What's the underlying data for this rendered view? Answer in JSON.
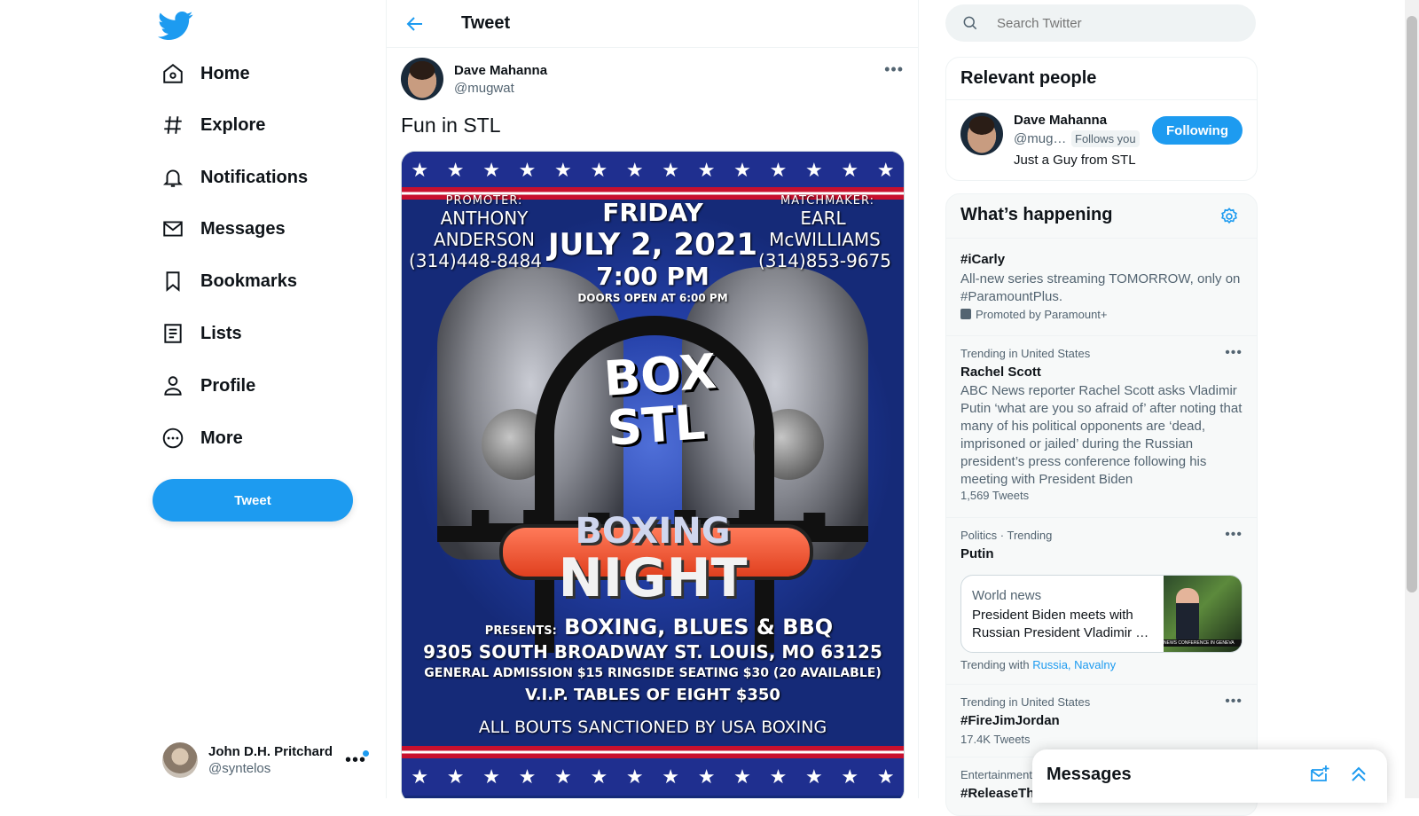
{
  "nav": {
    "items": [
      {
        "label": "Home",
        "icon": "home-icon"
      },
      {
        "label": "Explore",
        "icon": "hashtag-icon"
      },
      {
        "label": "Notifications",
        "icon": "bell-icon"
      },
      {
        "label": "Messages",
        "icon": "envelope-icon"
      },
      {
        "label": "Bookmarks",
        "icon": "bookmark-icon"
      },
      {
        "label": "Lists",
        "icon": "list-icon"
      },
      {
        "label": "Profile",
        "icon": "person-icon"
      },
      {
        "label": "More",
        "icon": "more-circle-icon"
      }
    ],
    "tweet_button": "Tweet"
  },
  "account": {
    "name": "John D.H. Pritchard",
    "handle": "@syntelos"
  },
  "center": {
    "title": "Tweet",
    "author": {
      "name": "Dave Mahanna",
      "handle": "@mugwat"
    },
    "text": "Fun in STL",
    "poster": {
      "promoter_label": "PROMOTER:",
      "promoter_name_1": "ANTHONY",
      "promoter_name_2": "ANDERSON",
      "promoter_phone": "(314)448-8484",
      "matchmaker_label": "MATCHMAKER:",
      "matchmaker_name_1": "EARL",
      "matchmaker_name_2": "McWILLIAMS",
      "matchmaker_phone": "(314)853-9675",
      "day": "FRIDAY",
      "date": "JULY 2, 2021",
      "time": "7:00 PM",
      "doors": "DOORS OPEN AT 6:00 PM",
      "logo": "BOX STL",
      "event_1": "BOXING",
      "event_2": "NIGHT",
      "presents": "PRESENTS:",
      "tagline": "BOXING, BLUES & BBQ",
      "address": "9305 SOUTH BROADWAY ST. LOUIS, MO 63125",
      "pricing": "GENERAL ADMISSION $15  RINGSIDE SEATING $30 (20 AVAILABLE)",
      "vip": "V.I.P. TABLES OF EIGHT $350",
      "sanction": "ALL BOUTS SANCTIONED BY USA BOXING",
      "star": "★"
    }
  },
  "search": {
    "placeholder": "Search Twitter"
  },
  "relevant": {
    "title": "Relevant people",
    "name": "Dave Mahanna",
    "handle": "@mug…",
    "follows_you": "Follows you",
    "bio": "Just a Guy from STL",
    "button": "Following"
  },
  "happening": {
    "title": "What’s happening",
    "trends": [
      {
        "title": "#iCarly",
        "desc": "All-new series streaming TOMORROW, only on #ParamountPlus.",
        "promoted": "Promoted by Paramount+"
      },
      {
        "meta": "Trending in United States",
        "title": "Rachel Scott",
        "desc": "ABC News reporter Rachel Scott asks Vladimir Putin ‘what are you so afraid of’ after noting that many of his political opponents are ‘dead, imprisoned or jailed’ during the Russian president’s press conference following his meeting with President Biden",
        "count": "1,569 Tweets"
      },
      {
        "meta": "Politics · Trending",
        "title": "Putin",
        "news_source": "World news",
        "news_headline": "President Biden meets with Russian President Vladimir …",
        "news_image_caption": "NEWS CONFERENCE IN GENEVA",
        "trending_with_label": "Trending with",
        "trending_with": "Russia, Navalny"
      },
      {
        "meta": "Trending in United States",
        "title": "#FireJimJordan",
        "count": "17.4K Tweets"
      },
      {
        "meta": "Entertainment",
        "title": "#ReleaseTh"
      }
    ]
  },
  "messages_drawer": {
    "title": "Messages"
  },
  "colors": {
    "accent": "#1d9bf0",
    "text": "#0f1419",
    "muted": "#536471"
  }
}
